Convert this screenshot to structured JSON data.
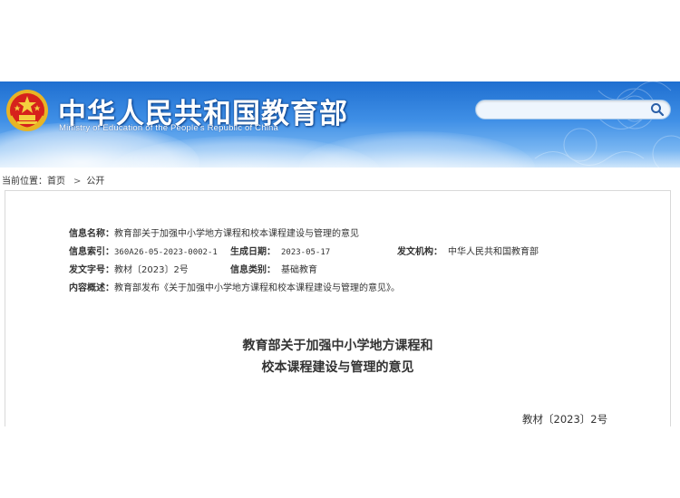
{
  "header": {
    "title": "中华人民共和国教育部",
    "subtitle": "Ministry of Education of the People's Republic of China",
    "emblem_icon": "national-emblem-icon",
    "search": {
      "placeholder": "",
      "value": "",
      "icon": "search-icon"
    },
    "colors": {
      "top": "#1f6fd0",
      "mid": "#3f8fe6",
      "bottom": "#cfe6fb"
    }
  },
  "breadcrumb": {
    "prefix": "当前位置：",
    "items": [
      "首页",
      "公开"
    ],
    "separator": ">"
  },
  "meta": {
    "name_label": "信息名称：",
    "name_value": "教育部关于加强中小学地方课程和校本课程建设与管理的意见",
    "index_label": "信息索引：",
    "index_value": "360A26-05-2023-0002-1",
    "date_label": "生成日期：",
    "date_value": "2023-05-17",
    "issuer_label": "发文机构：",
    "issuer_value": "中华人民共和国教育部",
    "docno_label": "发文字号：",
    "docno_value": "教材〔2023〕2号",
    "category_label": "信息类别：",
    "category_value": "基础教育",
    "summary_label": "内容概述：",
    "summary_value": "教育部发布《关于加强中小学地方课程和校本课程建设与管理的意见》。"
  },
  "document": {
    "title_line1": "教育部关于加强中小学地方课程和",
    "title_line2": "校本课程建设与管理的意见",
    "number": "教材〔2023〕2号"
  }
}
